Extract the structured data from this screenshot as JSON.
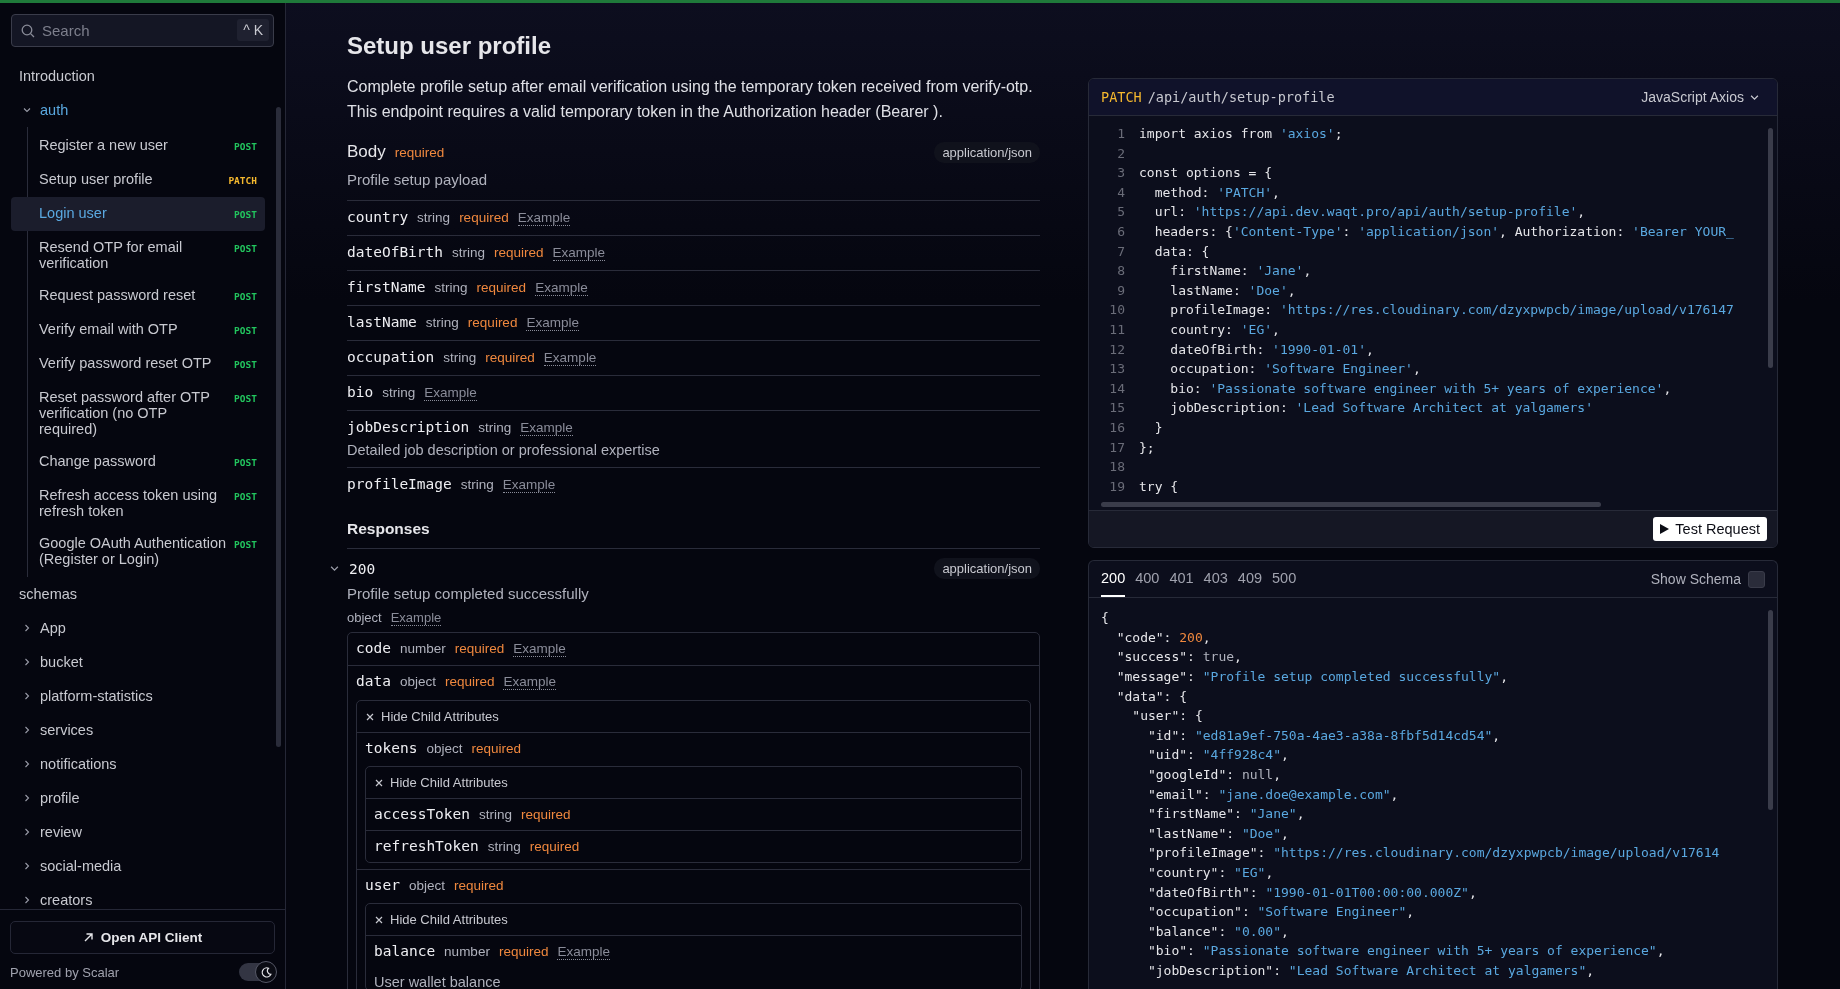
{
  "sidebar": {
    "search": {
      "placeholder": "Search",
      "shortcut": "^ K"
    },
    "items": [
      {
        "label": "Introduction",
        "kind": "link"
      },
      {
        "label": "auth",
        "kind": "group",
        "expanded": true,
        "children": [
          {
            "label": "Register a new user",
            "method": "POST",
            "color": "#22c55e",
            "selected": false
          },
          {
            "label": "Setup user profile",
            "method": "PATCH",
            "color": "#f5b82e",
            "selected": false
          },
          {
            "label": "Login user",
            "method": "POST",
            "color": "#22c55e",
            "selected": true
          },
          {
            "label": "Resend OTP for email verification",
            "method": "POST",
            "color": "#22c55e",
            "selected": false
          },
          {
            "label": "Request password reset",
            "method": "POST",
            "color": "#22c55e",
            "selected": false
          },
          {
            "label": "Verify email with OTP",
            "method": "POST",
            "color": "#22c55e",
            "selected": false
          },
          {
            "label": "Verify password reset OTP",
            "method": "POST",
            "color": "#22c55e",
            "selected": false
          },
          {
            "label": "Reset password after OTP verification (no OTP required)",
            "method": "POST",
            "color": "#22c55e",
            "selected": false
          },
          {
            "label": "Change password",
            "method": "POST",
            "color": "#22c55e",
            "selected": false
          },
          {
            "label": "Refresh access token using refresh token",
            "method": "POST",
            "color": "#22c55e",
            "selected": false
          },
          {
            "label": "Google OAuth Authentication (Register or Login)",
            "method": "POST",
            "color": "#22c55e",
            "selected": false
          }
        ]
      },
      {
        "label": "schemas",
        "kind": "link"
      },
      {
        "label": "App",
        "kind": "group",
        "expanded": false
      },
      {
        "label": "bucket",
        "kind": "group",
        "expanded": false
      },
      {
        "label": "platform-statistics",
        "kind": "group",
        "expanded": false
      },
      {
        "label": "services",
        "kind": "group",
        "expanded": false
      },
      {
        "label": "notifications",
        "kind": "group",
        "expanded": false
      },
      {
        "label": "profile",
        "kind": "group",
        "expanded": false
      },
      {
        "label": "review",
        "kind": "group",
        "expanded": false
      },
      {
        "label": "social-media",
        "kind": "group",
        "expanded": false
      },
      {
        "label": "creators",
        "kind": "group",
        "expanded": false
      }
    ],
    "open_client_button": "Open API Client",
    "powered_by": "Powered by Scalar",
    "dark_mode": true
  },
  "operation": {
    "title": "Setup user profile",
    "description": "Complete profile setup after email verification using the temporary token received from verify-otp. This endpoint requires a valid temporary token in the Authorization header (Bearer ).",
    "body": {
      "label": "Body",
      "required": "required",
      "content_type": "application/json",
      "description": "Profile setup payload",
      "fields": [
        {
          "name": "country",
          "type": "string",
          "required": "required",
          "example": "Example"
        },
        {
          "name": "dateOfBirth",
          "type": "string",
          "required": "required",
          "example": "Example"
        },
        {
          "name": "firstName",
          "type": "string",
          "required": "required",
          "example": "Example"
        },
        {
          "name": "lastName",
          "type": "string",
          "required": "required",
          "example": "Example"
        },
        {
          "name": "occupation",
          "type": "string",
          "required": "required",
          "example": "Example"
        },
        {
          "name": "bio",
          "type": "string",
          "example": "Example"
        },
        {
          "name": "jobDescription",
          "type": "string",
          "example": "Example",
          "description": "Detailed job description or professional expertise"
        },
        {
          "name": "profileImage",
          "type": "string",
          "example": "Example"
        }
      ]
    },
    "responses_heading": "Responses",
    "response": {
      "status": "200",
      "expanded": true,
      "content_type": "application/json",
      "description": "Profile setup completed successfully",
      "type": "object",
      "example": "Example",
      "fields": [
        {
          "name": "code",
          "type": "number",
          "required": "required",
          "example": "Example"
        },
        {
          "name": "data",
          "type": "object",
          "required": "required",
          "example": "Example",
          "hide_label": "Hide Child Attributes",
          "children": [
            {
              "name": "tokens",
              "type": "object",
              "required": "required",
              "hide_label": "Hide Child Attributes",
              "children": [
                {
                  "name": "accessToken",
                  "type": "string",
                  "required": "required"
                },
                {
                  "name": "refreshToken",
                  "type": "string",
                  "required": "required"
                }
              ]
            },
            {
              "name": "user",
              "type": "object",
              "required": "required",
              "hide_label": "Hide Child Attributes",
              "children": [
                {
                  "name": "balance",
                  "type": "number",
                  "required": "required",
                  "example": "Example",
                  "description": "User wallet balance"
                }
              ]
            }
          ]
        }
      ]
    }
  },
  "request_panel": {
    "method": "PATCH",
    "path": "/api/auth/setup-profile",
    "language": "JavaScript Axios",
    "button": "Test Request",
    "lines": [
      {
        "n": "1",
        "t": [
          {
            "text": "import axios from ",
            "kind": "plain"
          },
          {
            "text": "'axios'",
            "kind": "string"
          },
          {
            "text": ";",
            "kind": "plain"
          }
        ]
      },
      {
        "n": "2"
      },
      {
        "n": "3",
        "t": [
          {
            "text": "const options = {",
            "kind": "plain"
          }
        ]
      },
      {
        "n": "4",
        "t": [
          {
            "text": "  method: ",
            "kind": "plain"
          },
          {
            "text": "'PATCH'",
            "kind": "string"
          },
          {
            "text": ",",
            "kind": "plain"
          }
        ]
      },
      {
        "n": "5",
        "t": [
          {
            "text": "  url: ",
            "kind": "plain"
          },
          {
            "text": "'https://api.dev.waqt.pro/api/auth/setup-profile'",
            "kind": "string"
          },
          {
            "text": ",",
            "kind": "plain"
          }
        ]
      },
      {
        "n": "6",
        "t": [
          {
            "text": "  headers: {",
            "kind": "plain"
          },
          {
            "text": "'Content-Type'",
            "kind": "string"
          },
          {
            "text": ": ",
            "kind": "plain"
          },
          {
            "text": "'application/json'",
            "kind": "string"
          },
          {
            "text": ", Authorization: ",
            "kind": "plain"
          },
          {
            "text": "'Bearer YOUR_",
            "kind": "string"
          }
        ]
      },
      {
        "n": "7",
        "t": [
          {
            "text": "  data: {",
            "kind": "plain"
          }
        ]
      },
      {
        "n": "8",
        "t": [
          {
            "text": "    firstName: ",
            "kind": "plain"
          },
          {
            "text": "'Jane'",
            "kind": "string"
          },
          {
            "text": ",",
            "kind": "plain"
          }
        ]
      },
      {
        "n": "9",
        "t": [
          {
            "text": "    lastName: ",
            "kind": "plain"
          },
          {
            "text": "'Doe'",
            "kind": "string"
          },
          {
            "text": ",",
            "kind": "plain"
          }
        ]
      },
      {
        "n": "10",
        "t": [
          {
            "text": "    profileImage: ",
            "kind": "plain"
          },
          {
            "text": "'https://res.cloudinary.com/dzyxpwpcb/image/upload/v176147",
            "kind": "string"
          }
        ]
      },
      {
        "n": "11",
        "t": [
          {
            "text": "    country: ",
            "kind": "plain"
          },
          {
            "text": "'EG'",
            "kind": "string"
          },
          {
            "text": ",",
            "kind": "plain"
          }
        ]
      },
      {
        "n": "12",
        "t": [
          {
            "text": "    dateOfBirth: ",
            "kind": "plain"
          },
          {
            "text": "'1990-01-01'",
            "kind": "string"
          },
          {
            "text": ",",
            "kind": "plain"
          }
        ]
      },
      {
        "n": "13",
        "t": [
          {
            "text": "    occupation: ",
            "kind": "plain"
          },
          {
            "text": "'Software Engineer'",
            "kind": "string"
          },
          {
            "text": ",",
            "kind": "plain"
          }
        ]
      },
      {
        "n": "14",
        "t": [
          {
            "text": "    bio: ",
            "kind": "plain"
          },
          {
            "text": "'Passionate software engineer with 5+ years of experience'",
            "kind": "string"
          },
          {
            "text": ",",
            "kind": "plain"
          }
        ]
      },
      {
        "n": "15",
        "t": [
          {
            "text": "    jobDescription: ",
            "kind": "plain"
          },
          {
            "text": "'Lead Software Architect at yalgamers'",
            "kind": "string"
          }
        ]
      },
      {
        "n": "16",
        "t": [
          {
            "text": "  }",
            "kind": "plain"
          }
        ]
      },
      {
        "n": "17",
        "t": [
          {
            "text": "};",
            "kind": "plain"
          }
        ]
      },
      {
        "n": "18"
      },
      {
        "n": "19",
        "t": [
          {
            "text": "try {",
            "kind": "plain"
          }
        ]
      }
    ]
  },
  "response_panel": {
    "tabs": [
      {
        "label": "200",
        "selected": true
      },
      {
        "label": "400",
        "selected": false
      },
      {
        "label": "401",
        "selected": false
      },
      {
        "label": "403",
        "selected": false
      },
      {
        "label": "409",
        "selected": false
      },
      {
        "label": "500",
        "selected": false
      }
    ],
    "show_schema": {
      "label": "Show Schema",
      "checked": false
    },
    "lines": [
      [
        {
          "text": "{",
          "kind": "plain"
        }
      ],
      [
        {
          "text": "  \"code\": ",
          "kind": "plain"
        },
        {
          "text": "200",
          "kind": "number"
        },
        {
          "text": ",",
          "kind": "plain"
        }
      ],
      [
        {
          "text": "  \"success\": ",
          "kind": "plain"
        },
        {
          "text": "true",
          "kind": "literal"
        },
        {
          "text": ",",
          "kind": "plain"
        }
      ],
      [
        {
          "text": "  \"message\": ",
          "kind": "plain"
        },
        {
          "text": "\"Profile setup completed successfully\"",
          "kind": "string"
        },
        {
          "text": ",",
          "kind": "plain"
        }
      ],
      [
        {
          "text": "  \"data\": {",
          "kind": "plain"
        }
      ],
      [
        {
          "text": "    \"user\": {",
          "kind": "plain"
        }
      ],
      [
        {
          "text": "      \"id\": ",
          "kind": "plain"
        },
        {
          "text": "\"ed81a9ef-750a-4ae3-a38a-8fbf5d14cd54\"",
          "kind": "string"
        },
        {
          "text": ",",
          "kind": "plain"
        }
      ],
      [
        {
          "text": "      \"uid\": ",
          "kind": "plain"
        },
        {
          "text": "\"4ff928c4\"",
          "kind": "string"
        },
        {
          "text": ",",
          "kind": "plain"
        }
      ],
      [
        {
          "text": "      \"googleId\": ",
          "kind": "plain"
        },
        {
          "text": "null",
          "kind": "literal"
        },
        {
          "text": ",",
          "kind": "plain"
        }
      ],
      [
        {
          "text": "      \"email\": ",
          "kind": "plain"
        },
        {
          "text": "\"jane.doe@example.com\"",
          "kind": "string"
        },
        {
          "text": ",",
          "kind": "plain"
        }
      ],
      [
        {
          "text": "      \"firstName\": ",
          "kind": "plain"
        },
        {
          "text": "\"Jane\"",
          "kind": "string"
        },
        {
          "text": ",",
          "kind": "plain"
        }
      ],
      [
        {
          "text": "      \"lastName\": ",
          "kind": "plain"
        },
        {
          "text": "\"Doe\"",
          "kind": "string"
        },
        {
          "text": ",",
          "kind": "plain"
        }
      ],
      [
        {
          "text": "      \"profileImage\": ",
          "kind": "plain"
        },
        {
          "text": "\"https://res.cloudinary.com/dzyxpwpcb/image/upload/v17614",
          "kind": "string"
        }
      ],
      [
        {
          "text": "      \"country\": ",
          "kind": "plain"
        },
        {
          "text": "\"EG\"",
          "kind": "string"
        },
        {
          "text": ",",
          "kind": "plain"
        }
      ],
      [
        {
          "text": "      \"dateOfBirth\": ",
          "kind": "plain"
        },
        {
          "text": "\"1990-01-01T00:00:00.000Z\"",
          "kind": "string"
        },
        {
          "text": ",",
          "kind": "plain"
        }
      ],
      [
        {
          "text": "      \"occupation\": ",
          "kind": "plain"
        },
        {
          "text": "\"Software Engineer\"",
          "kind": "string"
        },
        {
          "text": ",",
          "kind": "plain"
        }
      ],
      [
        {
          "text": "      \"balance\": ",
          "kind": "plain"
        },
        {
          "text": "\"0.00\"",
          "kind": "string"
        },
        {
          "text": ",",
          "kind": "plain"
        }
      ],
      [
        {
          "text": "      \"bio\": ",
          "kind": "plain"
        },
        {
          "text": "\"Passionate software engineer with 5+ years of experience\"",
          "kind": "string"
        },
        {
          "text": ",",
          "kind": "plain"
        }
      ],
      [
        {
          "text": "      \"jobDescription\": ",
          "kind": "plain"
        },
        {
          "text": "\"Lead Software Architect at yalgamers\"",
          "kind": "string"
        },
        {
          "text": ",",
          "kind": "plain"
        }
      ]
    ]
  }
}
